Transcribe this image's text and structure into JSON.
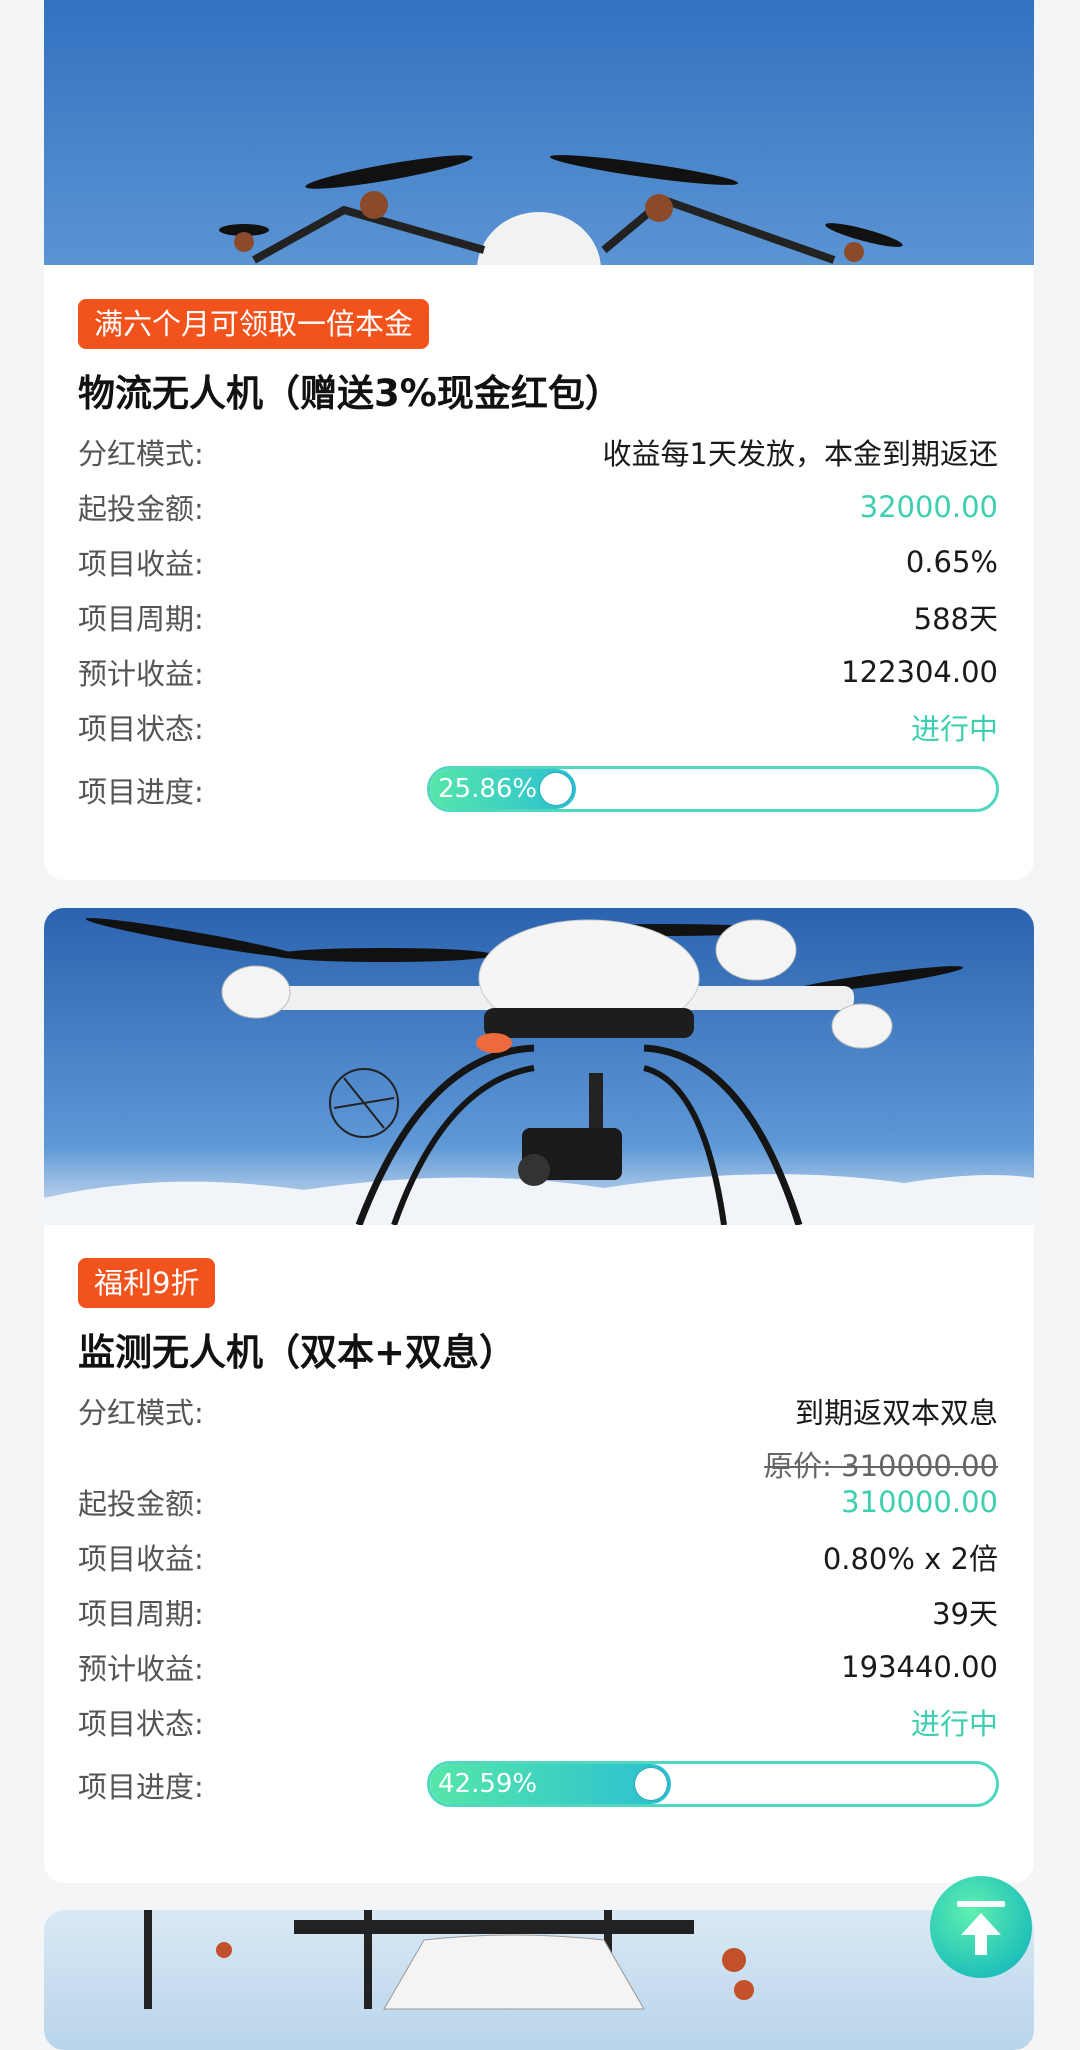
{
  "cards": [
    {
      "tag": "满六个月可领取一倍本金",
      "title": "物流无人机（赠送3%现金红包）",
      "rows": [
        {
          "label": "分红模式:",
          "value": "收益每1天发放，本金到期返还"
        },
        {
          "label": "起投金额:",
          "value": "32000.00"
        },
        {
          "label": "项目收益:",
          "value": "0.65%"
        },
        {
          "label": "项目周期:",
          "value": "588天"
        },
        {
          "label": "预计收益:",
          "value": "122304.00"
        },
        {
          "label": "项目状态:",
          "value": "进行中"
        }
      ],
      "progress_label": "项目进度:",
      "progress_text": "25.86%",
      "progress_fraction": 0.2586
    },
    {
      "tag": "福利9折",
      "title": "监测无人机（双本+双息）",
      "original_price": "原价: 310000.00",
      "rows": [
        {
          "label": "分红模式:",
          "value": "到期返双本双息"
        },
        {
          "label": "起投金额:",
          "value": "310000.00"
        },
        {
          "label": "项目收益:",
          "value": "0.80% x 2倍"
        },
        {
          "label": "项目周期:",
          "value": "39天"
        },
        {
          "label": "预计收益:",
          "value": "193440.00"
        },
        {
          "label": "项目状态:",
          "value": "进行中"
        }
      ],
      "progress_label": "项目进度:",
      "progress_text": "42.59%",
      "progress_fraction": 0.4259
    }
  ],
  "colors": {
    "accent_teal": "#3dcfb0",
    "tag_orange": "#f2531c",
    "progress_start": "#55e6a8",
    "progress_end": "#2bbfd4"
  },
  "icons": {
    "back_to_top": "arrow-up-to-line-icon"
  }
}
